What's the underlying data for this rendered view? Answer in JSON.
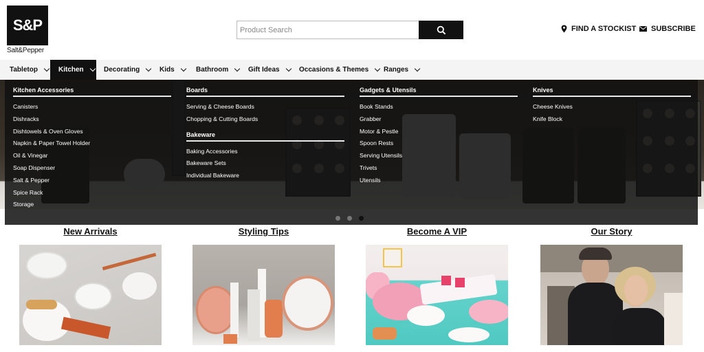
{
  "logo": {
    "mark": "S&P",
    "wordmark": "Salt&Pepper"
  },
  "search": {
    "placeholder": "Product Search"
  },
  "utility": {
    "stockist": "FIND A STOCKIST",
    "subscribe": "SUBSCRIBE"
  },
  "nav": [
    {
      "label": "Tabletop"
    },
    {
      "label": "Kitchen",
      "active": true
    },
    {
      "label": "Decorating"
    },
    {
      "label": "Kids"
    },
    {
      "label": "Bathroom"
    },
    {
      "label": "Gift Ideas"
    },
    {
      "label": "Occasions & Themes"
    },
    {
      "label": "Ranges"
    }
  ],
  "dropdown": {
    "col1": {
      "heading": "Kitchen Accessories",
      "links": [
        "Canisters",
        "Dishracks",
        "Dishtowels & Oven Gloves",
        "Napkin & Paper Towel Holder",
        "Oil & Vinegar",
        "Soap Dispenser",
        "Salt & Pepper",
        "Spice Rack",
        "Storage"
      ]
    },
    "col2": {
      "heading": "Boards",
      "links": [
        "Serving & Cheese Boards",
        "Chopping & Cutting Boards"
      ],
      "heading2": "Bakeware",
      "links2": [
        "Baking Accessories",
        "Bakeware Sets",
        "Individual Bakeware"
      ]
    },
    "col3": {
      "heading": "Gadgets & Utensils",
      "links": [
        "Book Stands",
        "Grabber",
        "Motor & Pestle",
        "Spoon Rests",
        "Serving Utensils",
        "Trivets",
        "Utensils"
      ]
    },
    "col4": {
      "heading": "Knives",
      "links": [
        "Cheese Knives",
        "Knife Block"
      ]
    }
  },
  "carousel": {
    "slides": 3,
    "active": 3
  },
  "tiles": [
    {
      "title": "New Arrivals"
    },
    {
      "title": "Styling Tips"
    },
    {
      "title": "Become A VIP"
    },
    {
      "title": "Our Story"
    }
  ],
  "colors": {
    "brand": "#111111",
    "navbar": "#f4f4f4",
    "dropdown_bg": "#121212"
  }
}
